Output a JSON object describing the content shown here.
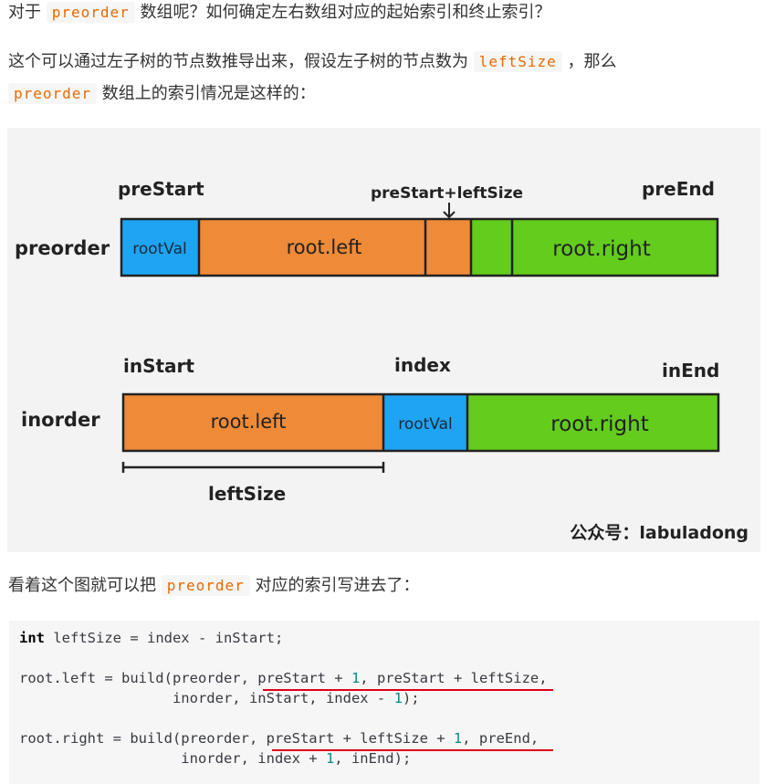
{
  "paragraph1": {
    "prefix": "对于",
    "code": "preorder",
    "suffix": "数组呢？如何确定左右数组对应的起始索引和终止索引？"
  },
  "paragraph2": {
    "line1_text": "这个可以通过左子树的节点数推导出来，假设左子树的节点数为",
    "line1_code": "leftSize",
    "line1_end": "，那么",
    "line2_code": "preorder",
    "line2_text": "数组上的索引情况是这样的："
  },
  "figure": {
    "preorder_label": "preorder",
    "inorder_label": "inorder",
    "preStart": "preStart",
    "preStartLeftSize": "preStart+leftSize",
    "preEnd": "preEnd",
    "inStart": "inStart",
    "index": "index",
    "inEnd": "inEnd",
    "rootVal": "rootVal",
    "root_left": "root.left",
    "root_right": "root.right",
    "leftSize": "leftSize",
    "watermark": "公众号：labuladong",
    "colors": {
      "blue": "#1ea4f2",
      "orange": "#ef8a37",
      "green": "#63cc1c"
    }
  },
  "paragraph3": {
    "prefix": "看着这个图就可以把",
    "code": "preorder",
    "suffix": "对应的索引写进去了："
  },
  "code": {
    "l1_kw": "int",
    "l1_rest": " leftSize = index - inStart;",
    "l2_a": "root.left = build(preorder, preStart + ",
    "l2_n1": "1",
    "l2_b": ", preStart + leftSize,",
    "l3_a": "                  inorder, inStart, index - ",
    "l3_n1": "1",
    "l3_b": ");",
    "l4_a": "root.right = build(preorder, preStart + leftSize + ",
    "l4_n1": "1",
    "l4_b": ", preEnd,",
    "l5_a": "                   inorder, index + ",
    "l5_n1": "1",
    "l5_b": ", inEnd);"
  }
}
